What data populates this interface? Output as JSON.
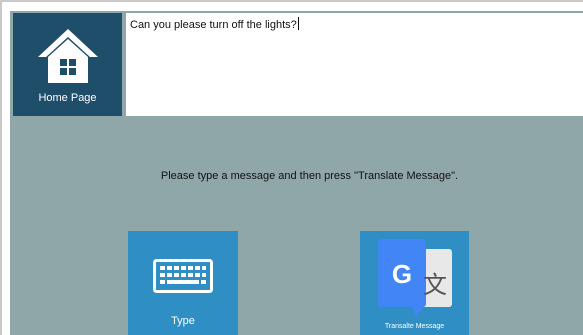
{
  "home": {
    "label": "Home Page"
  },
  "message": {
    "value": "Can you please turn off the lights?"
  },
  "instruction": {
    "text": "Please type a message and then press \"Translate Message\"."
  },
  "buttons": {
    "type_label": "Type",
    "translate_label": "Transalte Message"
  },
  "translate_icon": {
    "g_letter": "G",
    "wen_char": "文"
  },
  "colors": {
    "background": "#8fa7a9",
    "home_tile": "#1f4e6b",
    "action_tile": "#2f8fc4",
    "google_blue": "#4285f4",
    "translate_gray": "#e8e8e8"
  },
  "icons": {
    "home": "house-icon",
    "type": "keyboard-icon",
    "translate": "google-translate-icon"
  }
}
